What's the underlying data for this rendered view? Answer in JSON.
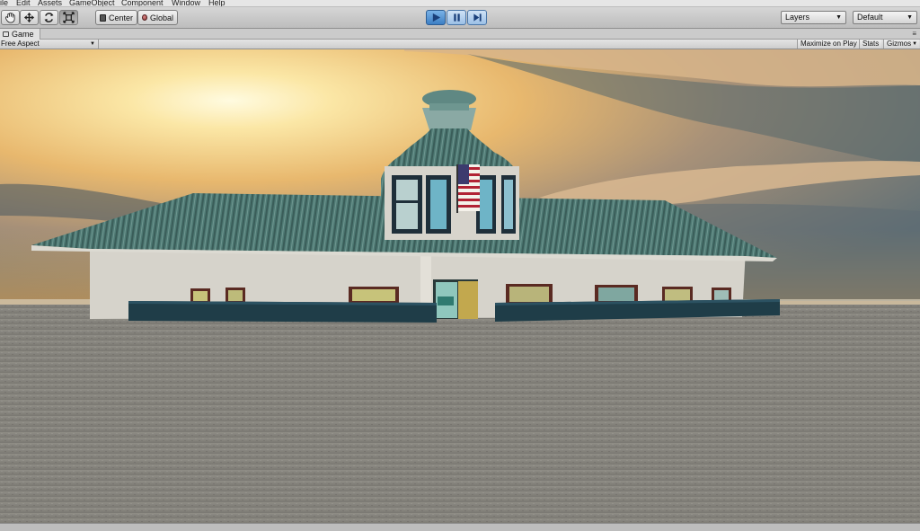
{
  "menu": {
    "items": [
      "ile",
      "Edit",
      "Assets",
      "GameObject",
      "Component",
      "Window",
      "Help"
    ]
  },
  "toolbar": {
    "tools": [
      {
        "name": "hand-icon",
        "active": false
      },
      {
        "name": "move-icon",
        "active": false
      },
      {
        "name": "rotate-icon",
        "active": false
      },
      {
        "name": "scale-icon",
        "active": true
      }
    ],
    "pivot_label": "Center",
    "space_label": "Global",
    "play_state": "playing",
    "layers_label": "Layers",
    "layout_label": "Default"
  },
  "tab": {
    "label": "Game"
  },
  "gameview": {
    "aspect_label": "Free Aspect",
    "maximize_label": "Maximize on Play",
    "stats_label": "Stats",
    "gizmos_label": "Gizmos"
  },
  "colors": {
    "accent_play": "#3d7fc4",
    "roof": "#4f7a74",
    "wall": "#d6d3cb",
    "planter": "#1f3d48",
    "ground": "#8a8880"
  }
}
